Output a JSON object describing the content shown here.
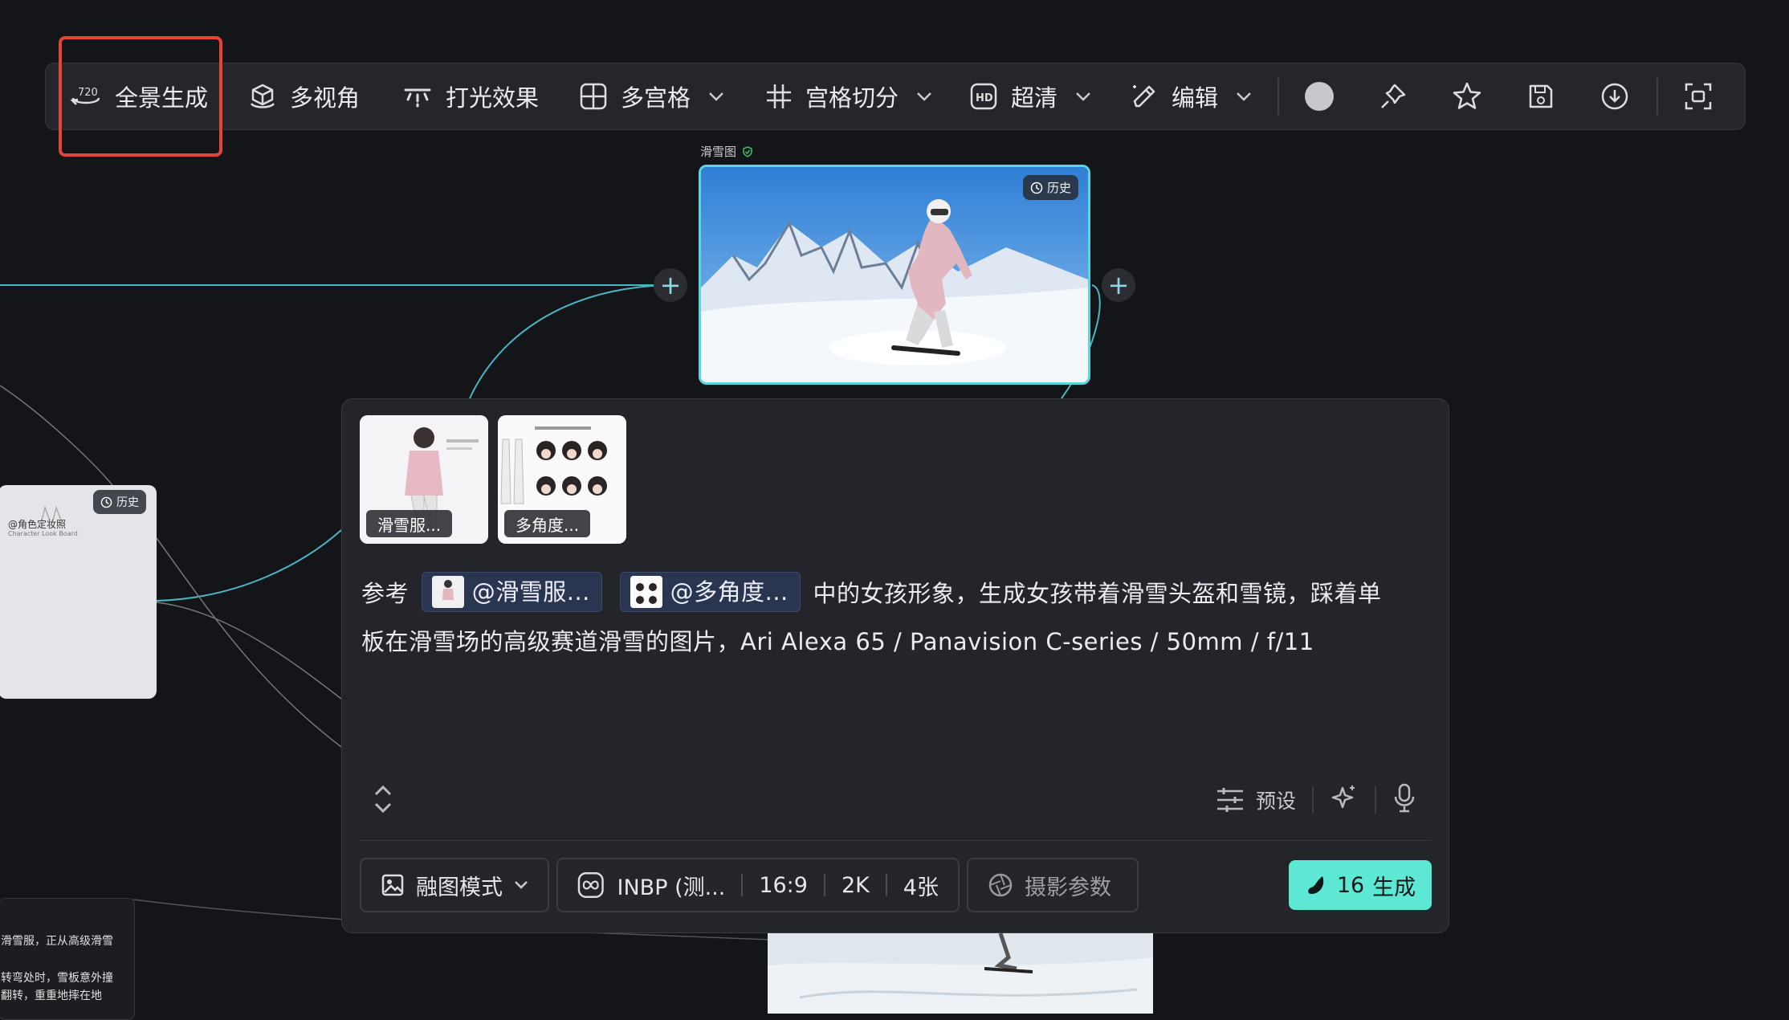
{
  "toolbar": {
    "items": [
      {
        "label": "全景生成",
        "icon": "panorama-720-icon"
      },
      {
        "label": "多视角",
        "icon": "cube-rotate-icon"
      },
      {
        "label": "打光效果",
        "icon": "lighting-icon"
      },
      {
        "label": "多宫格",
        "icon": "grid-icon"
      },
      {
        "label": "宫格切分",
        "icon": "hash-icon"
      },
      {
        "label": "超清",
        "icon": "hd-icon"
      },
      {
        "label": "编辑",
        "icon": "pencil-sparkle-icon"
      }
    ],
    "icons": [
      "color-dot-icon",
      "pin-icon",
      "star-icon",
      "save-image-icon",
      "download-icon",
      "scan-icon"
    ]
  },
  "node": {
    "title": "滑雪图",
    "history_label": "历史"
  },
  "left_card": {
    "history_label": "历史",
    "title": "@角色定妆照",
    "subtitle": "Character Look Board"
  },
  "note_card": {
    "line1": "滑雪服，正从高级滑雪",
    "line2": "转弯处时，雪板意外撞",
    "line3": "翻转，重重地摔在地"
  },
  "panel": {
    "refs": [
      {
        "label": "滑雪服..."
      },
      {
        "label": "多角度..."
      }
    ],
    "prompt": {
      "prefix": "参考",
      "mention1": "@滑雪服...",
      "mention2": "@多角度...",
      "text1": "中的女孩形象，生成女孩带着滑雪头盔和雪镜，踩着单",
      "text2": "板在滑雪场的高级赛道滑雪的图片，Ari Alexa 65 / Panavision C-series / 50mm / f/11"
    },
    "tools": {
      "preset_label": "预设"
    },
    "bottom": {
      "mode": "融图模式",
      "model": "INBP (测...",
      "ratio": "16:9",
      "resolution": "2K",
      "count": "4张",
      "camera": "摄影参数",
      "generate_cost": "16",
      "generate_label": "生成"
    }
  },
  "colors": {
    "accent": "#5de8d4",
    "highlight": "#e5443b",
    "wire": "#5fc8d6"
  }
}
